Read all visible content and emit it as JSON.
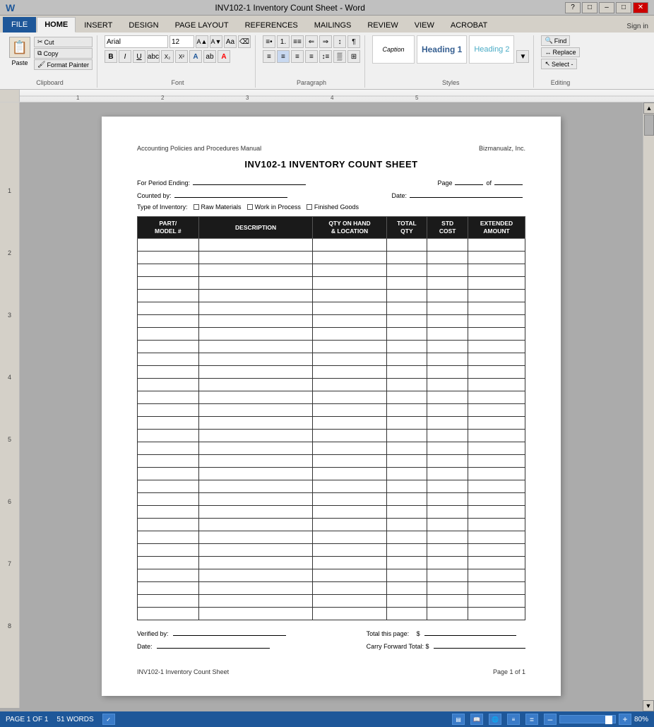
{
  "titlebar": {
    "title": "INV102-1 Inventory Count Sheet - Word",
    "controls": [
      "?",
      "□",
      "–",
      "□",
      "✕"
    ]
  },
  "ribbon": {
    "tabs": [
      "FILE",
      "HOME",
      "INSERT",
      "DESIGN",
      "PAGE LAYOUT",
      "REFERENCES",
      "MAILINGS",
      "REVIEW",
      "VIEW",
      "ACROBAT"
    ],
    "active_tab": "HOME",
    "sign_in": "Sign in",
    "groups": {
      "clipboard": {
        "label": "Clipboard",
        "paste": "Paste",
        "cut": "Cut",
        "copy": "Copy",
        "format_painter": "Format Painter"
      },
      "font": {
        "label": "Font",
        "font_name": "Arial",
        "font_size": "12",
        "bold": "B",
        "italic": "I",
        "underline": "U"
      },
      "paragraph": {
        "label": "Paragraph"
      },
      "styles": {
        "label": "Styles",
        "items": [
          "Caption",
          "Heading 1",
          "Heading 2"
        ]
      },
      "editing": {
        "label": "Editing",
        "find": "Find",
        "replace": "Replace",
        "select": "Select -"
      }
    }
  },
  "document": {
    "header_left": "Accounting Policies and Procedures Manual",
    "header_right": "Bizmanualz, Inc.",
    "title": "INV102-1 INVENTORY COUNT SHEET",
    "period_ending_label": "For Period Ending:",
    "page_label": "Page",
    "of_label": "of",
    "counted_by_label": "Counted by:",
    "date_label": "Date:",
    "type_of_inv_label": "Type of Inventory:",
    "raw_materials": "Raw Materials",
    "work_in_process": "Work in Process",
    "finished_goods": "Finished Goods",
    "table": {
      "headers": [
        "PART/\nMODEL #",
        "DESCRIPTION",
        "QTY ON HAND\n& LOCATION",
        "TOTAL\nQTY",
        "STD\nCOST",
        "EXTENDED\nAMOUNT"
      ],
      "row_count": 30
    },
    "footer": {
      "verified_by_label": "Verified by:",
      "date_label": "Date:",
      "total_this_page_label": "Total this page:",
      "total_this_page_value": "$",
      "carry_forward_label": "Carry Forward Total: $"
    },
    "page_footer_left": "INV102-1 Inventory Count Sheet",
    "page_footer_right": "Page 1 of 1"
  },
  "statusbar": {
    "page": "PAGE 1 OF 1",
    "words": "51 WORDS",
    "zoom": "80%"
  }
}
